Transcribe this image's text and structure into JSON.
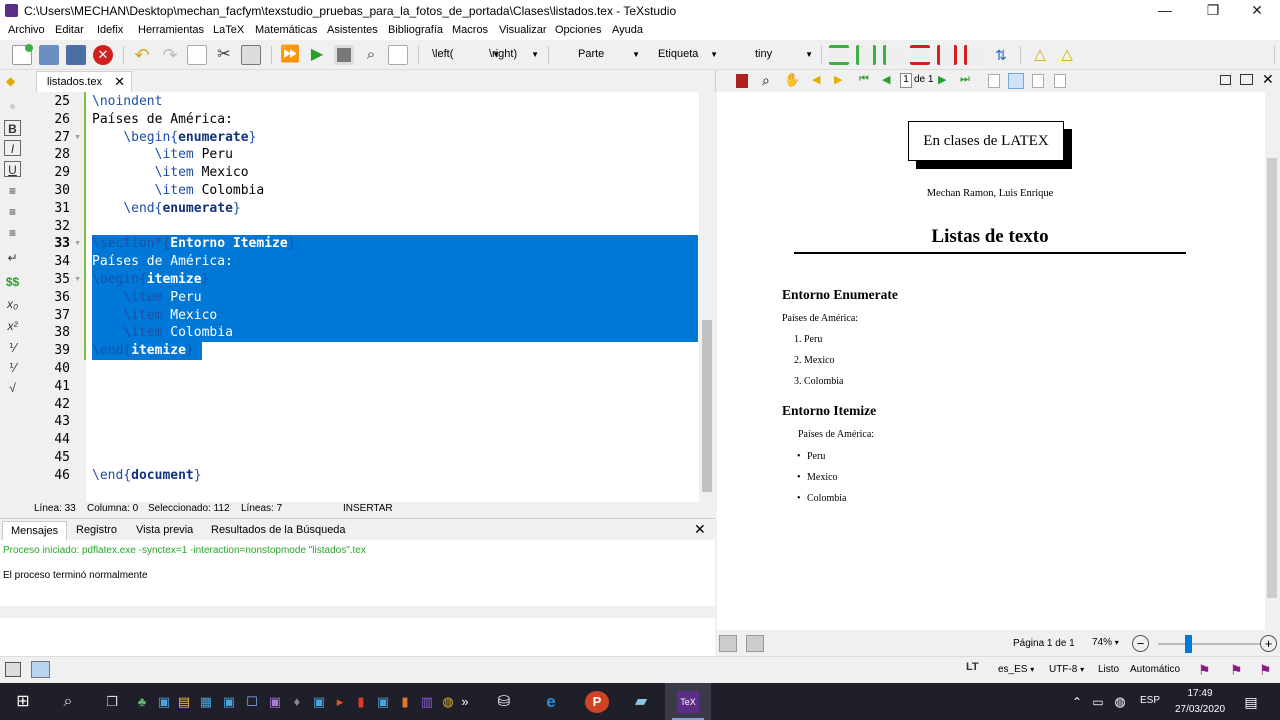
{
  "window": {
    "title": "C:\\Users\\MECHAN\\Desktop\\mechan_facfym\\texstudio_pruebas_para_la_fotos_de_portada\\Clases\\listados.tex - TeXstudio",
    "minimize": "—",
    "maximize": "❐",
    "close": "✕"
  },
  "menu": [
    "Archivo",
    "Editar",
    "Idefix",
    "Herramientas",
    "LaTeX",
    "Matemáticas",
    "Asistentes",
    "Bibliografía",
    "Macros",
    "Visualizar",
    "Opciones",
    "Ayuda"
  ],
  "toolbar": {
    "left_combo": "\\left(",
    "right_combo": "\\right)",
    "part_combo": "Parte",
    "label_combo": "Etiqueta",
    "size_combo": "tiny"
  },
  "tab": {
    "label": "listados.tex",
    "close": "✕"
  },
  "editor": {
    "lines": [
      {
        "n": "25",
        "text": "\\noindent"
      },
      {
        "n": "26",
        "text": "Países de América:"
      },
      {
        "n": "27",
        "text": "    \\begin{enumerate}",
        "fold": true
      },
      {
        "n": "28",
        "text": "        \\item Peru"
      },
      {
        "n": "29",
        "text": "        \\item Mexico"
      },
      {
        "n": "30",
        "text": "        \\item Colombia"
      },
      {
        "n": "31",
        "text": "    \\end{enumerate}"
      },
      {
        "n": "32",
        "text": ""
      },
      {
        "n": "33",
        "text": "\\section*{Entorno Itemize}",
        "fold": true,
        "selected": true
      },
      {
        "n": "34",
        "text": "Países de América:",
        "selected": true
      },
      {
        "n": "35",
        "text": "\\begin{itemize}",
        "fold": true,
        "selected": true
      },
      {
        "n": "36",
        "text": "    \\item Peru",
        "selected": true
      },
      {
        "n": "37",
        "text": "    \\item Mexico",
        "selected": true
      },
      {
        "n": "38",
        "text": "    \\item Colombia",
        "selected": true
      },
      {
        "n": "39",
        "text": "\\end{itemize}",
        "selected": true
      },
      {
        "n": "40",
        "text": ""
      },
      {
        "n": "41",
        "text": ""
      },
      {
        "n": "42",
        "text": ""
      },
      {
        "n": "43",
        "text": ""
      },
      {
        "n": "44",
        "text": ""
      },
      {
        "n": "45",
        "text": ""
      },
      {
        "n": "46",
        "text": "\\end{document}"
      }
    ]
  },
  "status": {
    "line": "Línea: 33",
    "column": "Columna: 0",
    "selected": "Seleccionado: 112",
    "lines": "Líneas: 7",
    "mode": "INSERTAR"
  },
  "messages": {
    "tabs": [
      "Mensajes",
      "Registro",
      "Vista previa",
      "Resultados de la Búsqueda"
    ],
    "close": "✕",
    "line1": "Proceso iniciado: pdflatex.exe -synctex=1 -interaction=nonstopmode \"listados\".tex",
    "line2": "El proceso terminó normalmente"
  },
  "pdf": {
    "page_input": "1",
    "page_of": "de 1",
    "title_box": "En clases de LATEX",
    "author": "Mechan Ramon, Luis Enrique",
    "main_title": "Listas de texto",
    "sections": [
      {
        "heading": "Entorno Enumerate",
        "intro": "Países de América:",
        "items": [
          "1.  Peru",
          "2.  Mexico",
          "3.  Colombia"
        ]
      },
      {
        "heading": "Entorno Itemize",
        "intro": "Países de América:",
        "items": [
          "Peru",
          "Mexico",
          "Colombia"
        ]
      }
    ],
    "page_status": "Página 1 de 1",
    "zoom": "74%"
  },
  "bottombar": {
    "lang": "es_ES",
    "encoding": "UTF-8",
    "ready": "Listo",
    "auto": "Automático"
  },
  "taskbar": {
    "time": "17:49",
    "date": "27/03/2020",
    "lang": "ESP"
  },
  "colors": {
    "selection": "#0078d7",
    "keyword": "#1d4fa8",
    "success_msg": "#28a428",
    "change_marker": "#7ac143"
  }
}
